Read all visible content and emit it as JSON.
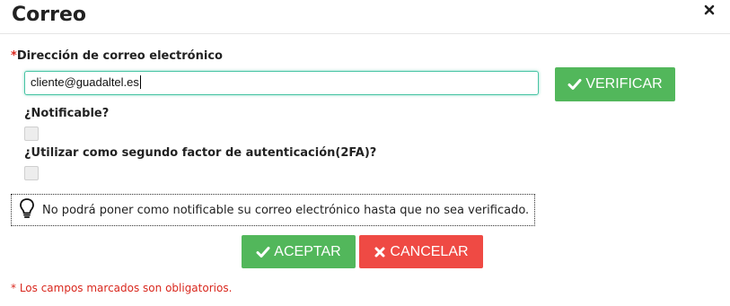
{
  "dialog": {
    "title": "Correo",
    "close_icon": "close-icon"
  },
  "email_field": {
    "required_mark": "*",
    "label": "Dirección de correo electrónico",
    "value": "cliente@guadaltel.es"
  },
  "verify_button": {
    "label": "VERIFICAR",
    "icon": "check-icon"
  },
  "notifiable": {
    "label": "¿Notificable?",
    "checked": false
  },
  "two_factor": {
    "label": "¿Utilizar como segundo factor de autenticación(2FA)?",
    "checked": false
  },
  "notice": {
    "icon": "lightbulb-icon",
    "text": "No podrá poner como notificable su correo electrónico hasta que no sea verificado."
  },
  "actions": {
    "accept_label": "ACEPTAR",
    "cancel_label": "CANCELAR"
  },
  "footnote": "* Los campos marcados son obligatorios.",
  "colors": {
    "green": "#52b75b",
    "red": "#ef4a44",
    "required": "#d9281e",
    "input_focus": "#48c4a4"
  }
}
